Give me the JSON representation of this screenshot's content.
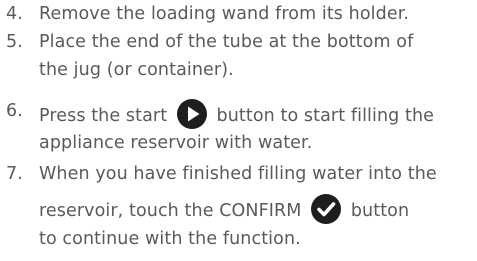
{
  "steps": [
    {
      "number": "4.",
      "lines": [
        "Remove the loading wand from its holder."
      ]
    },
    {
      "number": "5.",
      "lines": [
        "Place the end of the tube at the bottom of",
        "the jug (or container)."
      ]
    },
    {
      "number": "6.",
      "before_icon": "Press the start",
      "icon": "play-icon",
      "after_icon": "button to start filling the",
      "lines": [
        "appliance reservoir with water."
      ]
    },
    {
      "number": "7.",
      "lines": [
        "When you have finished filling water into the"
      ],
      "line2_before_icon": "reservoir, touch the CONFIRM",
      "icon": "checkmark-icon",
      "line2_after_icon": "button",
      "line3": "to continue with the function."
    }
  ],
  "colors": {
    "text": "#5a5a5a",
    "icon": "#1e1e1e"
  }
}
